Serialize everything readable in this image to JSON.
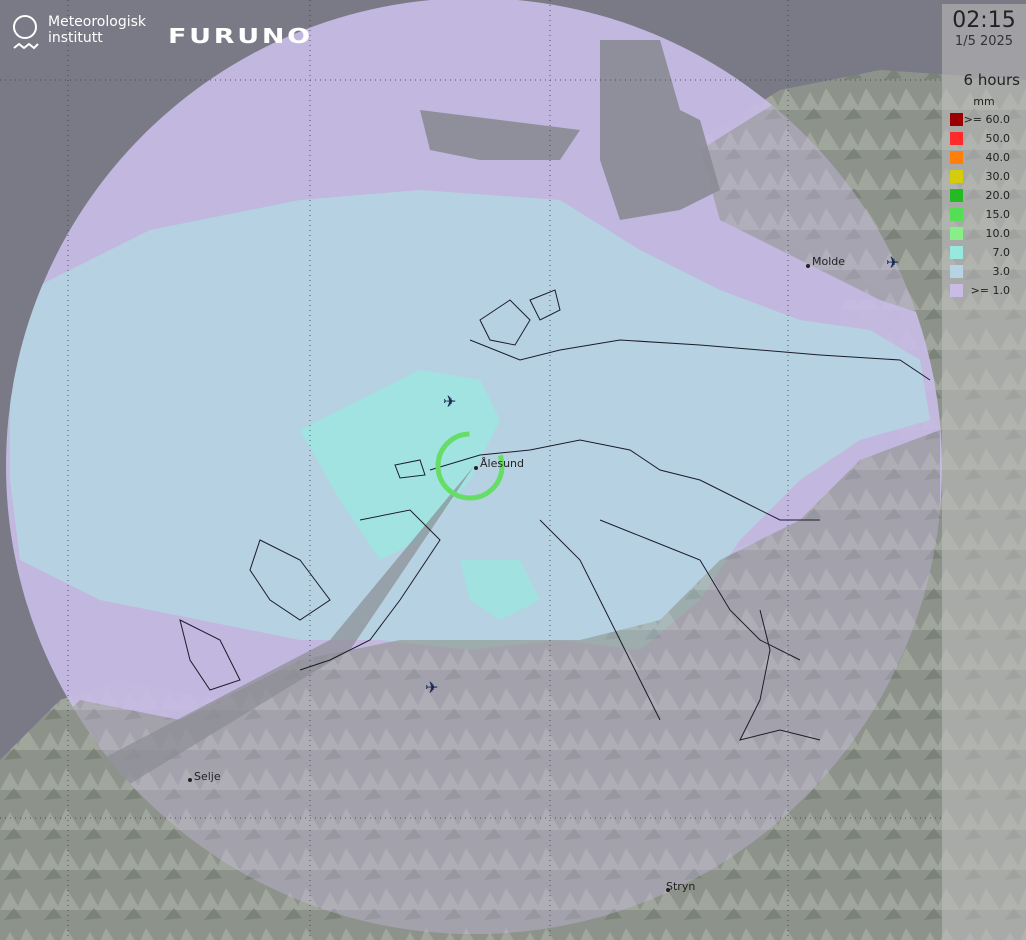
{
  "header": {
    "met_logo_text_line1": "Meteorologisk",
    "met_logo_text_line2": "institutt",
    "partner_logo_text": "FURUNO"
  },
  "panel": {
    "time": "02:15",
    "date": "1/5 2025",
    "period": "6 hours",
    "unit": "mm"
  },
  "legend": [
    {
      "label": ">= 60.0",
      "color": "#9b0000"
    },
    {
      "label": "50.0",
      "color": "#ff2a2a"
    },
    {
      "label": "40.0",
      "color": "#ff7f0a"
    },
    {
      "label": "30.0",
      "color": "#d4cc0c"
    },
    {
      "label": "20.0",
      "color": "#22bb22"
    },
    {
      "label": "15.0",
      "color": "#55dd55"
    },
    {
      "label": "10.0",
      "color": "#88ee88"
    },
    {
      "label": "7.0",
      "color": "#99e8e0"
    },
    {
      "label": "3.0",
      "color": "#b5d3e2"
    },
    {
      "label": ">= 1.0",
      "color": "#c8bce6"
    }
  ],
  "places": [
    {
      "name": "Ålesund"
    },
    {
      "name": "Molde"
    },
    {
      "name": "Selje"
    },
    {
      "name": "Stryn"
    }
  ],
  "colors": {
    "sea": "#7a7a86",
    "land": "#8f968c",
    "precip_1": "#c8bce6",
    "precip_3": "#b5d3e2",
    "precip_7": "#99e8e0",
    "radar_ring": "#66dd66"
  }
}
